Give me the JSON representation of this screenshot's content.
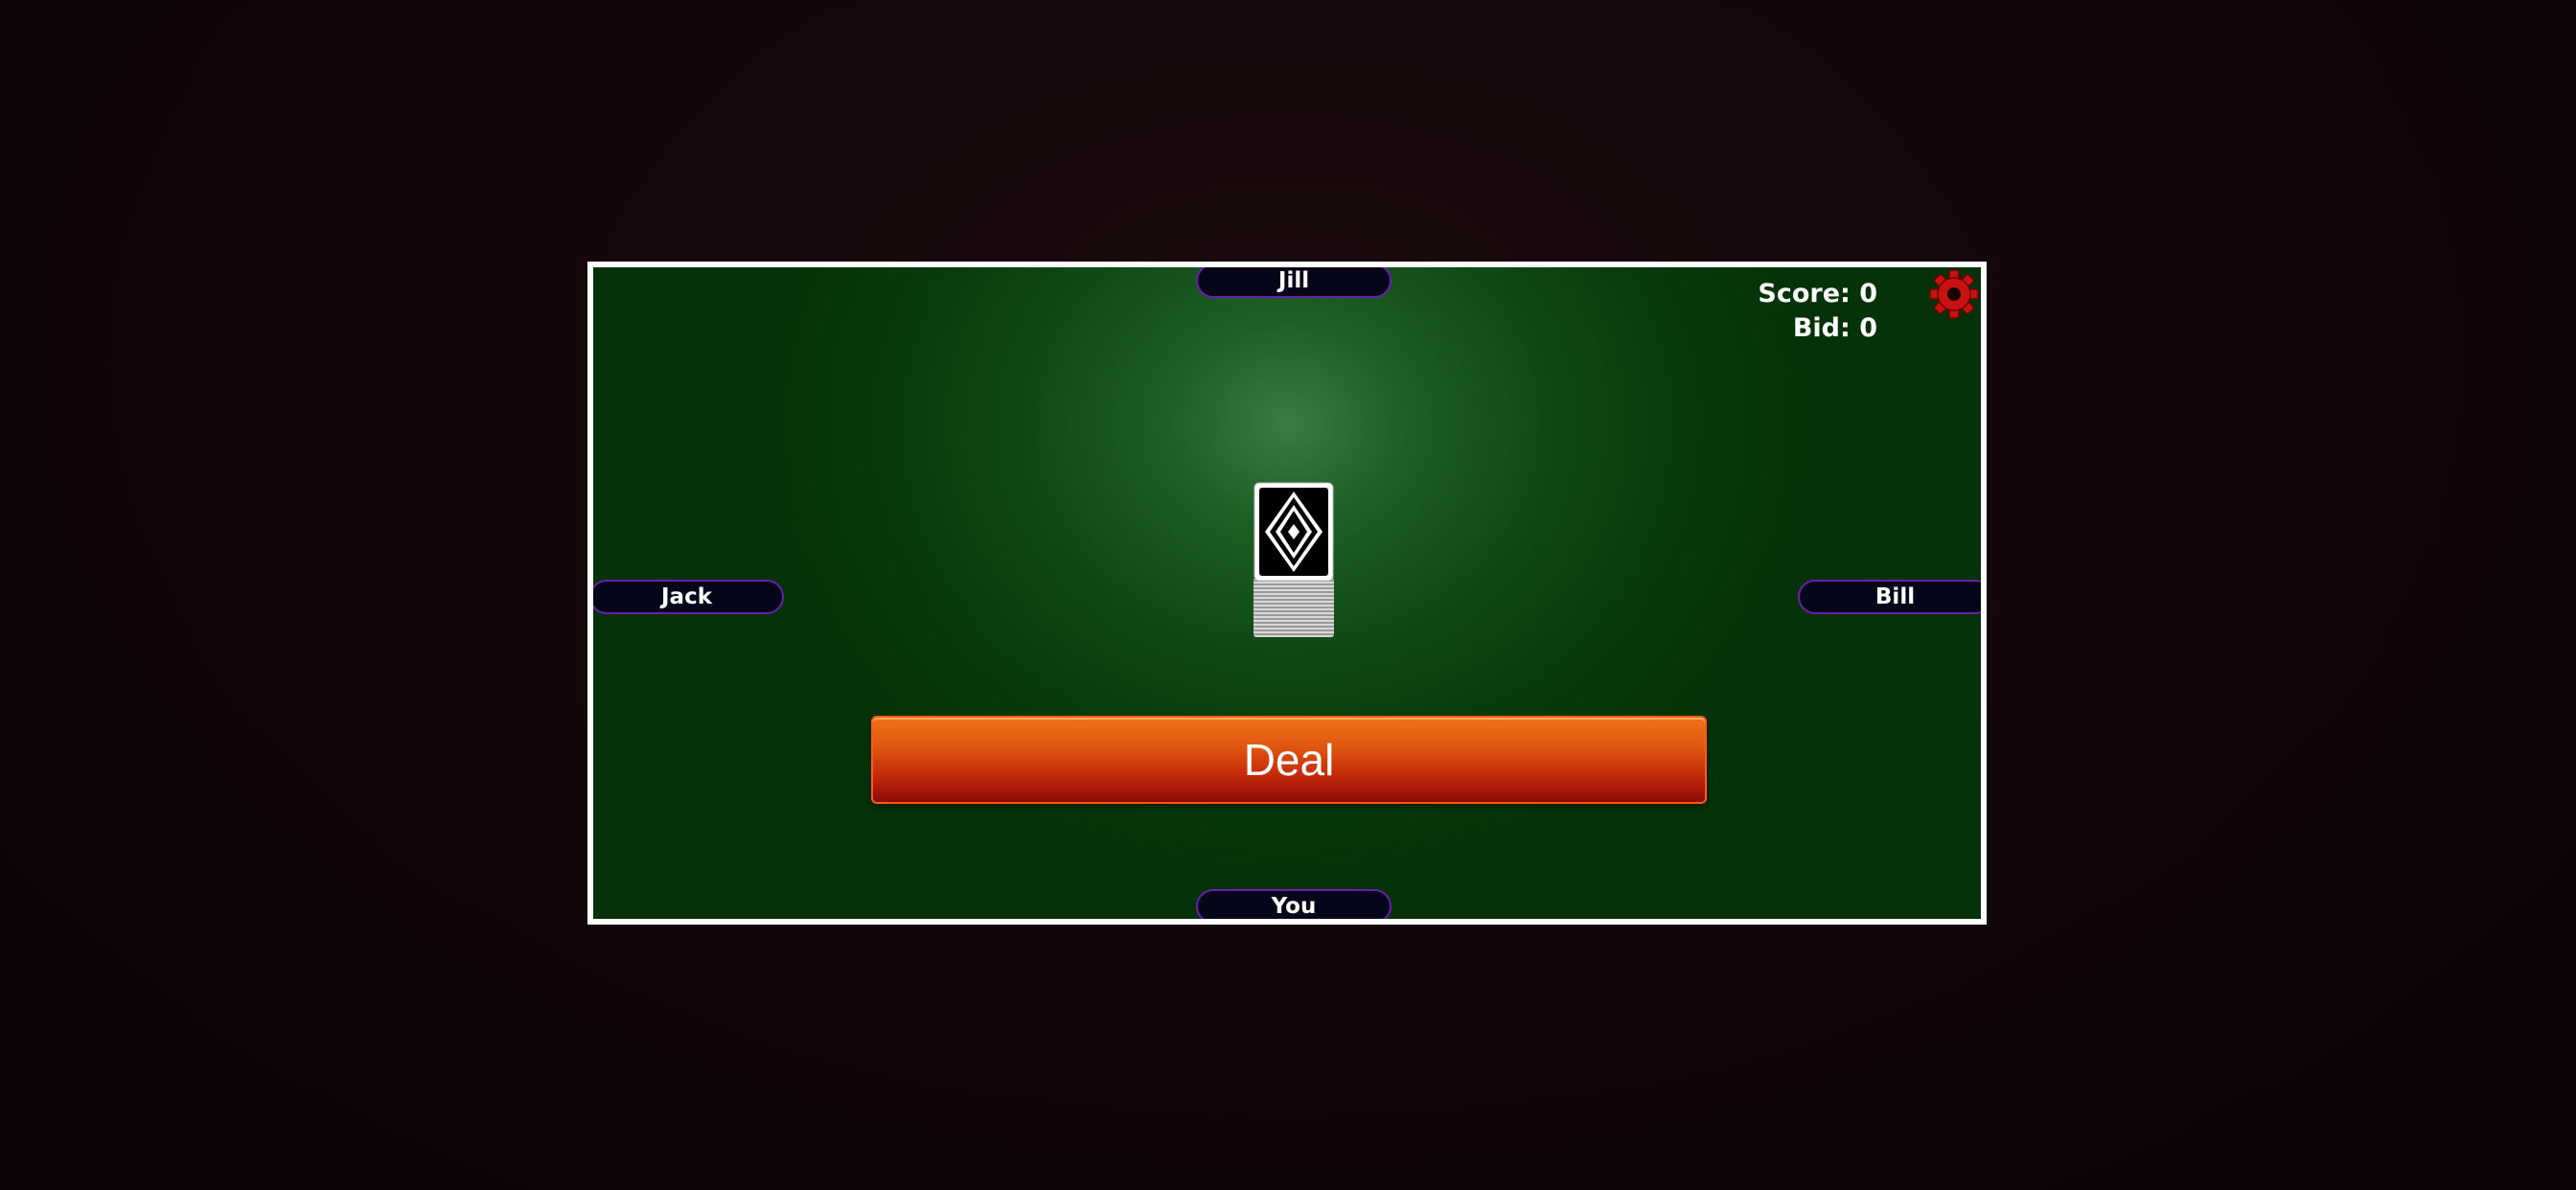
{
  "players": {
    "top": "Jill",
    "left": "Jack",
    "right": "Bill",
    "bottom": "You"
  },
  "status": {
    "score_label": "Score: 0",
    "bid_label": "Bid: 0"
  },
  "icons": {
    "settings": "gear-icon",
    "deck": "card-back-icon"
  },
  "actions": {
    "deal_label": "Deal"
  },
  "colors": {
    "felt": "#0f4a15",
    "table_border": "#ffffff",
    "seat_border": "#6b1fb0",
    "deal_button": "#e0560f",
    "gear": "#d01414"
  }
}
